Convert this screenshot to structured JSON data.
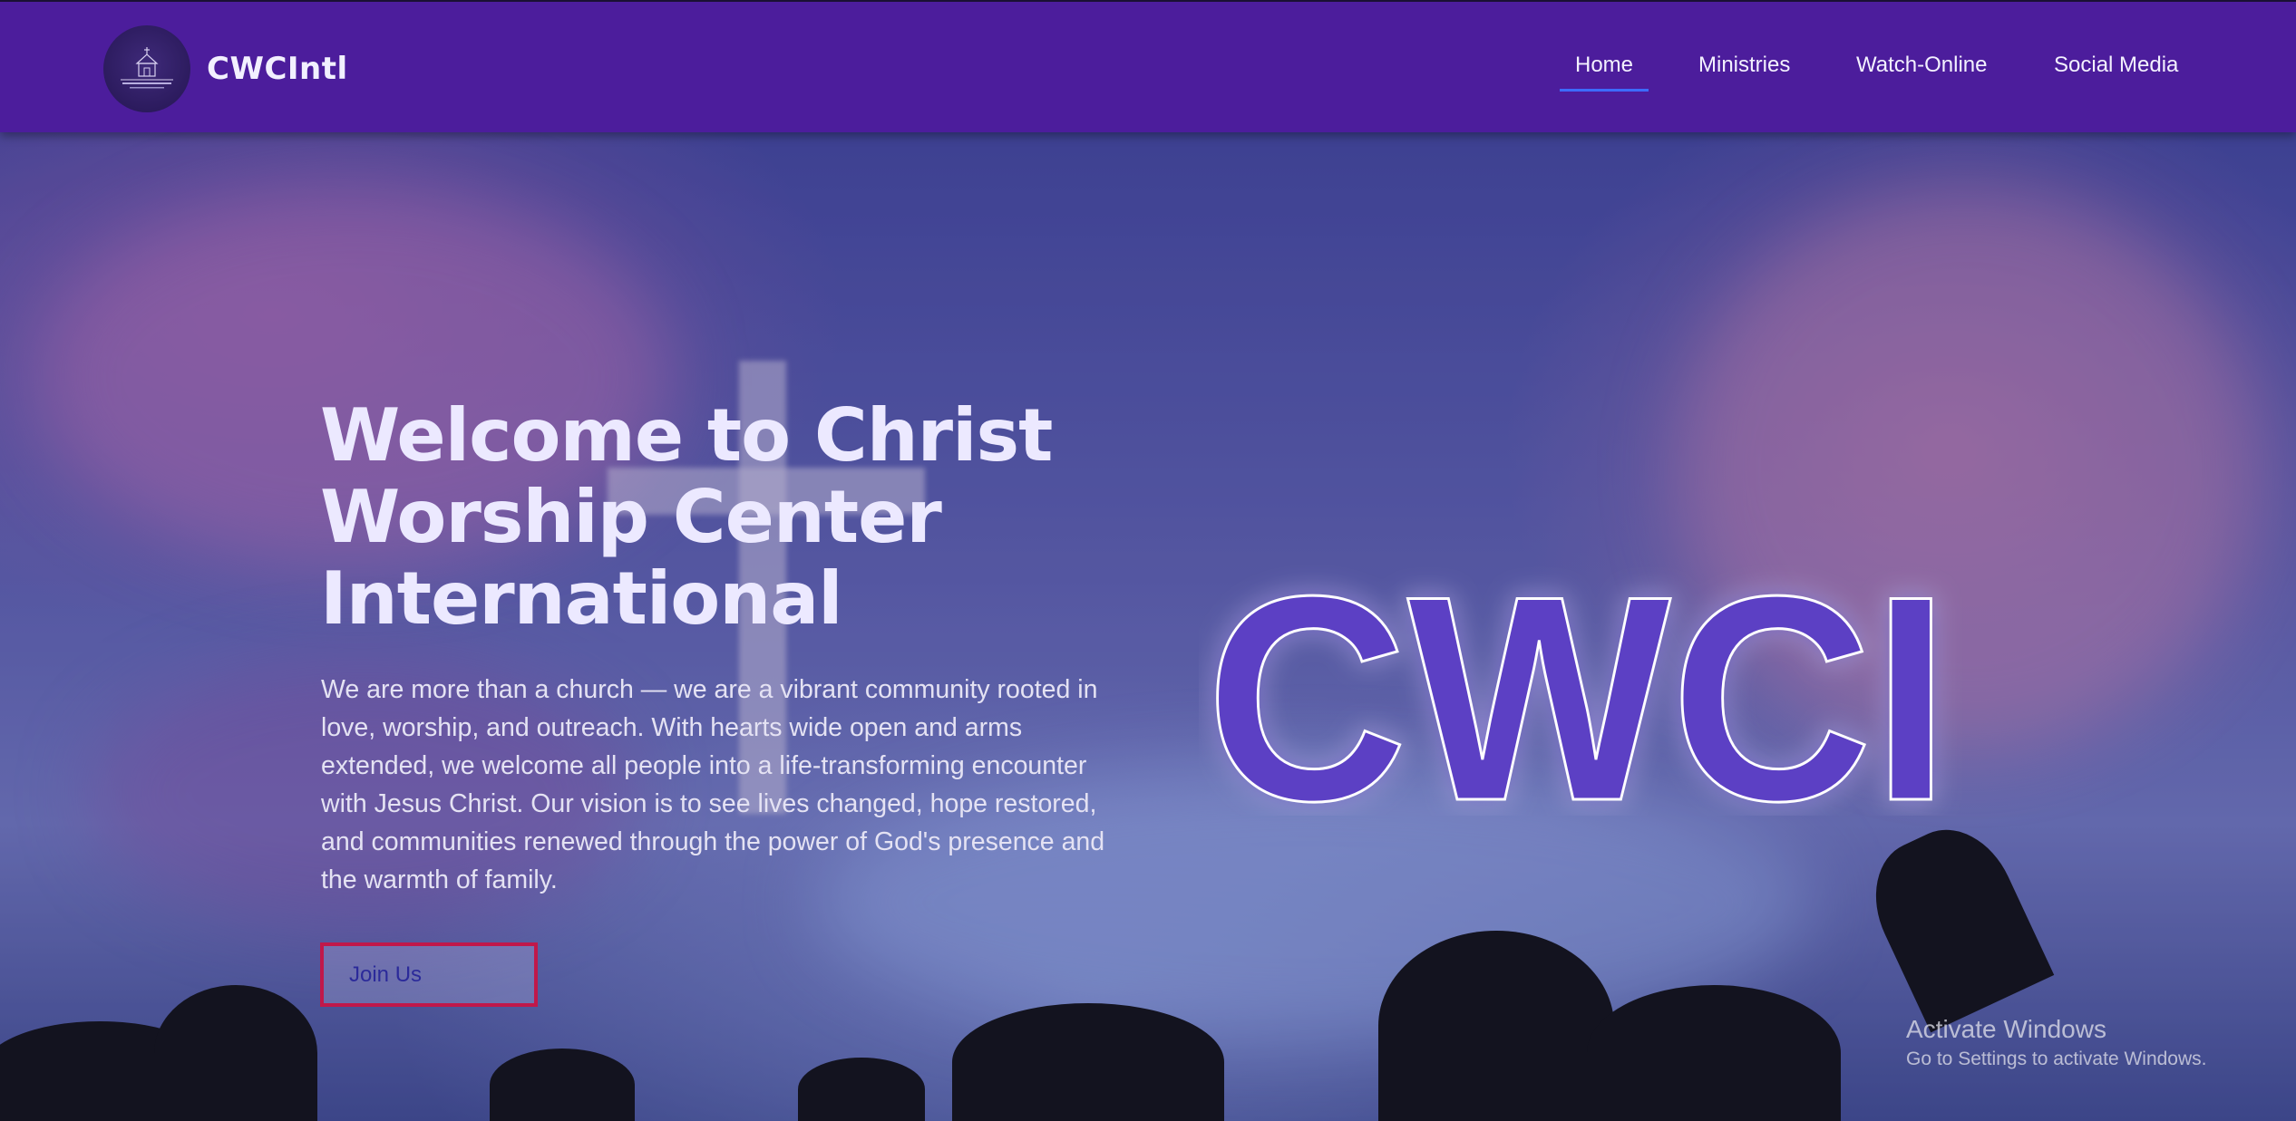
{
  "header": {
    "brand_name": "CWCIntl",
    "nav": {
      "home": "Home",
      "ministries": "Ministries",
      "watch_online": "Watch-Online",
      "social_media": "Social Media"
    },
    "active_item": "home",
    "colors": {
      "navbar_bg": "#4c1d9c",
      "active_underline": "#3d6bff"
    }
  },
  "hero": {
    "title": "Welcome to Christ Worship Center International",
    "description": "We are more than a church — we are a vibrant community rooted in love, worship, and outreach. With hearts wide open and arms extended, we welcome all people into a life-transforming encounter with Jesus Christ. Our vision is to see lives changed, hope restored, and communities renewed through the power of God's presence and the warmth of family.",
    "cta_label": "Join Us",
    "big_brand_text": "CWCI",
    "colors": {
      "cta_border": "#c0184a",
      "brand_fill": "#5b3fc4"
    }
  },
  "system_watermark": {
    "title": "Activate Windows",
    "subtitle": "Go to Settings to activate Windows."
  }
}
